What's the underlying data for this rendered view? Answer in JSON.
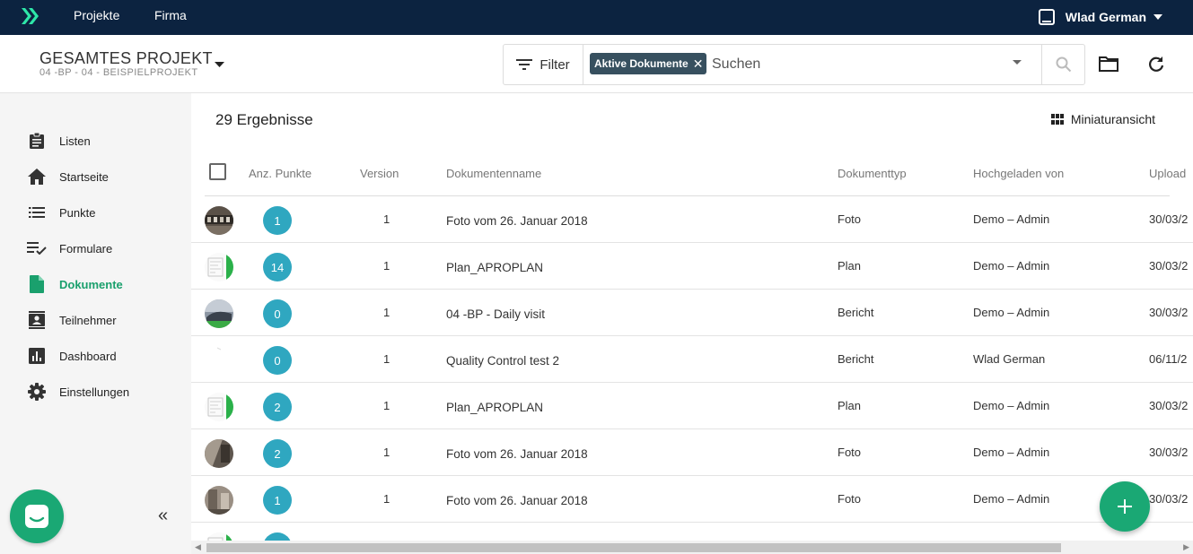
{
  "topbar": {
    "nav": [
      "Projekte",
      "Firma"
    ],
    "user_name": "Wlad German"
  },
  "project": {
    "title": "GESAMTES PROJEKT",
    "subtitle": "04 -BP - 04 - BEISPIELPROJEKT"
  },
  "search": {
    "filter_label": "Filter",
    "chip_label": "Aktive Dokumente",
    "placeholder": "Suchen"
  },
  "sidebar": {
    "items": [
      {
        "label": "Listen",
        "icon": "clipboard-icon"
      },
      {
        "label": "Startseite",
        "icon": "home-icon"
      },
      {
        "label": "Punkte",
        "icon": "list-icon"
      },
      {
        "label": "Formulare",
        "icon": "checklist-icon"
      },
      {
        "label": "Dokumente",
        "icon": "document-icon",
        "active": true
      },
      {
        "label": "Teilnehmer",
        "icon": "contacts-icon"
      },
      {
        "label": "Dashboard",
        "icon": "bar-chart-icon"
      },
      {
        "label": "Einstellungen",
        "icon": "gear-icon"
      }
    ]
  },
  "main": {
    "results": "29 Ergebnisse",
    "view_toggle": "Miniaturansicht",
    "columns": [
      "Anz. Punkte",
      "Version",
      "Dokumentenname",
      "Dokumenttyp",
      "Hochgeladen von",
      "Upload"
    ],
    "rows": [
      {
        "thumb": "photo",
        "points": "1",
        "version": "1",
        "name": "Foto vom 26. Januar 2018",
        "type": "Foto",
        "by": "Demo – Admin",
        "date": "30/03/2"
      },
      {
        "thumb": "plan",
        "points": "14",
        "version": "1",
        "name": "Plan_APROPLAN",
        "type": "Plan",
        "by": "Demo – Admin",
        "date": "30/03/2"
      },
      {
        "thumb": "report",
        "points": "0",
        "version": "1",
        "name": "04 -BP - Daily visit",
        "type": "Bericht",
        "by": "Demo – Admin",
        "date": "30/03/2"
      },
      {
        "thumb": "blank",
        "points": "0",
        "version": "1",
        "name": "Quality Control test 2",
        "type": "Bericht",
        "by": "Wlad German",
        "date": "06/11/2"
      },
      {
        "thumb": "plan",
        "points": "2",
        "version": "1",
        "name": "Plan_APROPLAN",
        "type": "Plan",
        "by": "Demo – Admin",
        "date": "30/03/2"
      },
      {
        "thumb": "photo2",
        "points": "2",
        "version": "1",
        "name": "Foto vom 26. Januar 2018",
        "type": "Foto",
        "by": "Demo – Admin",
        "date": "30/03/2"
      },
      {
        "thumb": "photo3",
        "points": "1",
        "version": "1",
        "name": "Foto vom 26. Januar 2018",
        "type": "Foto",
        "by": "Demo – Admin",
        "date": "30/03/2"
      },
      {
        "thumb": "plan",
        "points": "",
        "version": "",
        "name": "",
        "type": "",
        "by": "",
        "date": ""
      }
    ]
  },
  "colors": {
    "topbar": "#0c2340",
    "accent": "#1aa874",
    "badge": "#2fa7c0",
    "chip": "#37505f"
  }
}
